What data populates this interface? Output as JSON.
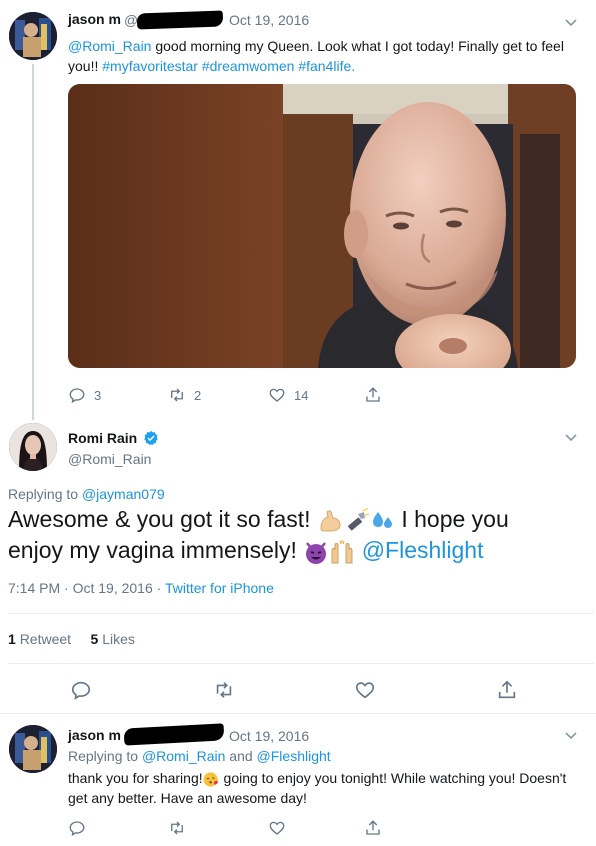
{
  "tweet1": {
    "name": "jason m",
    "handle_prefix": "@",
    "date": "Oct 19, 2016",
    "mention": "@Romi_Rain",
    "text": " good morning my Queen. Look what I got today! Finally get to feel you!! ",
    "hashtags": "#myfavoritestar #dreamwomen #fan4life.",
    "counts": {
      "reply": "3",
      "retweet": "2",
      "like": "14"
    }
  },
  "main_tweet": {
    "name": "Romi Rain",
    "handle": "@Romi_Rain",
    "reply_label": "Replying to ",
    "reply_to": "@jayman079",
    "text_part1": "Awesome & you got it so fast! ",
    "text_part2": " I hope you enjoy my vagina immensely! ",
    "mention": "@Fleshlight",
    "time": "7:14 PM · Oct 19, 2016 · ",
    "source": "Twitter for iPhone",
    "retweets_count": "1",
    "retweets_label": "Retweet",
    "likes_count": "5",
    "likes_label": "Likes"
  },
  "tweet3": {
    "name": "jason m",
    "date": "Oct 19, 2016",
    "reply_label": "Replying to ",
    "reply_to1": "@Romi_Rain",
    "reply_and": " and ",
    "reply_to2": "@Fleshlight",
    "text_part1": "thank you for sharing!",
    "text_part2": " going to enjoy you tonight! While watching you! Doesn't get any better. Have an awesome day!"
  },
  "colors": {
    "link": "#1b95e0",
    "muted": "#657786",
    "verified": "#1da1f2"
  },
  "icons": [
    "chevron-down-icon",
    "reply-icon",
    "retweet-icon",
    "like-icon",
    "share-icon",
    "verified-icon"
  ]
}
